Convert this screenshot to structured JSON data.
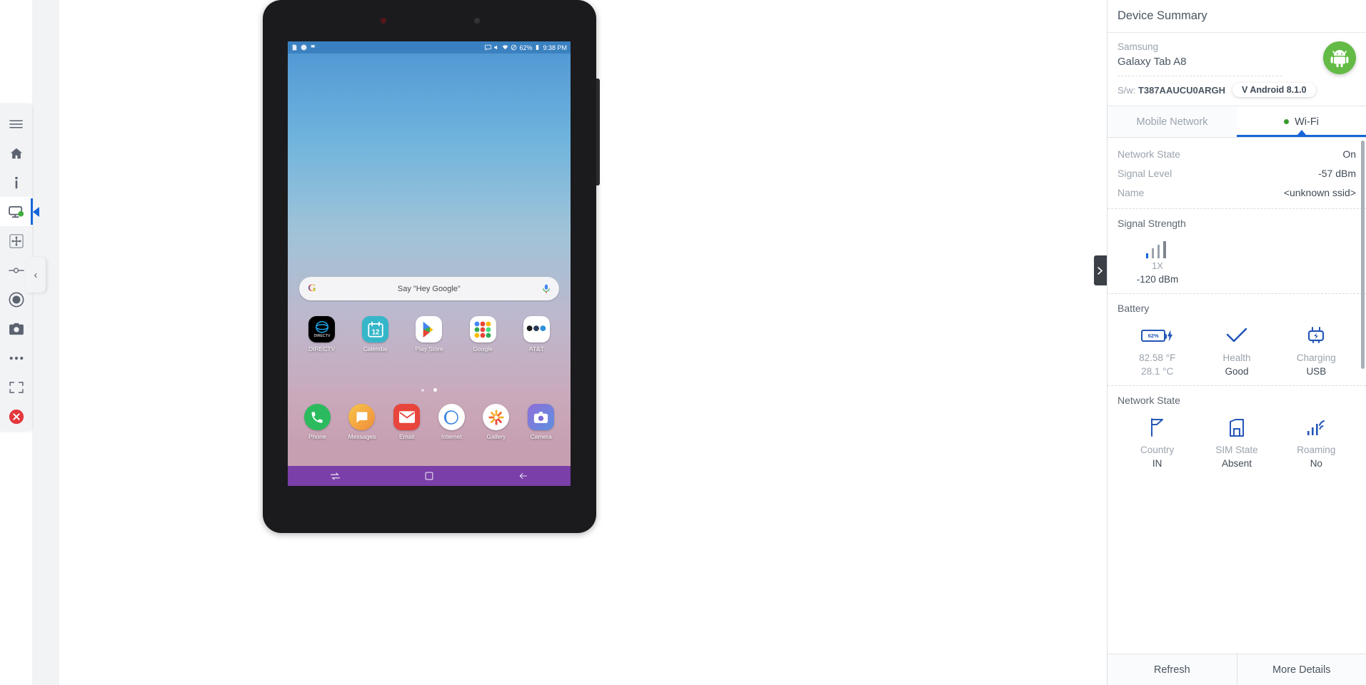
{
  "left_toolbar": {
    "items": [
      {
        "name": "menu-icon",
        "label": "Menu"
      },
      {
        "name": "home-icon",
        "label": "Home"
      },
      {
        "name": "info-icon",
        "label": "Info"
      },
      {
        "name": "device-monitor-icon",
        "label": "Device"
      },
      {
        "name": "pan-move-icon",
        "label": "Move"
      },
      {
        "name": "slider-icon",
        "label": "Settings"
      },
      {
        "name": "record-icon",
        "label": "Record"
      },
      {
        "name": "camera-icon",
        "label": "Screenshot"
      },
      {
        "name": "more-ellipsis-icon",
        "label": "More"
      },
      {
        "name": "fullscreen-icon",
        "label": "Fullscreen"
      },
      {
        "name": "close-icon",
        "label": "Close"
      }
    ],
    "collapse_label": "‹"
  },
  "device_screen": {
    "statusbar": {
      "battery": "62%",
      "time": "9:38 PM"
    },
    "search": {
      "g_logo": "G",
      "placeholder": "Say \"Hey Google\"",
      "mic_icon": "mic-icon"
    },
    "apps_row1": [
      {
        "label": "DIRECTV",
        "icon": "directv-icon"
      },
      {
        "label": "Calendar",
        "icon": "calendar-icon",
        "day": "12"
      },
      {
        "label": "Play Store",
        "icon": "play-store-icon"
      },
      {
        "label": "Google",
        "icon": "google-folder-icon"
      },
      {
        "label": "AT&T",
        "icon": "att-folder-icon"
      }
    ],
    "apps_row2": [
      {
        "label": "Phone",
        "icon": "phone-icon"
      },
      {
        "label": "Messages",
        "icon": "messages-icon"
      },
      {
        "label": "Email",
        "icon": "email-icon"
      },
      {
        "label": "Internet",
        "icon": "internet-icon"
      },
      {
        "label": "Gallery",
        "icon": "gallery-icon"
      },
      {
        "label": "Camera",
        "icon": "camera-app-icon"
      }
    ],
    "navbar": [
      "recents-icon",
      "home-square-icon",
      "back-icon"
    ]
  },
  "right_panel": {
    "title": "Device Summary",
    "brand": "Samsung",
    "model": "Galaxy Tab A8",
    "sw_label": "S/w:",
    "sw_value": "T387AAUCU0ARGH",
    "os_chip": "V Android 8.1.0",
    "android_icon": "android-robot-icon",
    "tabs": [
      {
        "label": "Mobile Network",
        "active": false,
        "dot": false
      },
      {
        "label": "Wi-Fi",
        "active": true,
        "dot": true
      }
    ],
    "wifi_rows": [
      {
        "key": "Network State",
        "value": "On"
      },
      {
        "key": "Signal Level",
        "value": "-57 dBm"
      },
      {
        "key": "Name",
        "value": "<unknown ssid>"
      }
    ],
    "signal_strength": {
      "title": "Signal Strength",
      "icon": "signal-bars-icon",
      "technology": "1X",
      "dbm": "-120 dBm"
    },
    "battery": {
      "title": "Battery",
      "cells": [
        {
          "icon": "battery-charging-icon",
          "value": "62%",
          "line1": "82.58 °F",
          "line2": "28.1 °C"
        },
        {
          "icon": "check-icon",
          "line1": "Health",
          "line2": "Good"
        },
        {
          "icon": "power-plug-icon",
          "line1": "Charging",
          "line2": "USB"
        }
      ]
    },
    "network_state": {
      "title": "Network State",
      "cells": [
        {
          "icon": "flag-icon",
          "line1": "Country",
          "line2": "IN"
        },
        {
          "icon": "sim-card-icon",
          "line1": "SIM State",
          "line2": "Absent"
        },
        {
          "icon": "roaming-signal-icon",
          "line1": "Roaming",
          "line2": "No"
        }
      ]
    },
    "footer": {
      "refresh": "Refresh",
      "more_details": "More Details"
    },
    "handle_icon": "panel-collapse-icon"
  },
  "colors": {
    "accent_blue": "#1565d8",
    "icon_blue": "#2456b8",
    "android_green": "#63bb46",
    "close_red": "#e3373c",
    "navbar_purple": "#7a3fa8"
  }
}
